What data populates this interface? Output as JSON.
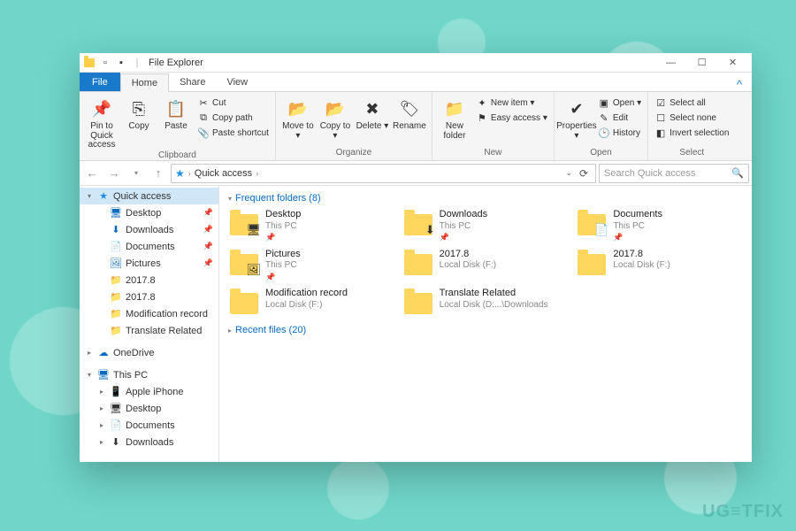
{
  "watermark": "UG≡TFIX",
  "title": "File Explorer",
  "win_buttons": {
    "min": "—",
    "max": "☐",
    "close": "✕"
  },
  "tabs": {
    "file": "File",
    "items": [
      "Home",
      "Share",
      "View"
    ],
    "active": 0,
    "help": "^"
  },
  "ribbon_groups": {
    "clipboard": {
      "label": "Clipboard",
      "pin": "Pin to Quick\naccess",
      "copy": "Copy",
      "paste": "Paste",
      "cut": "Cut",
      "copypath": "Copy path",
      "pasteshort": "Paste shortcut"
    },
    "organize": {
      "label": "Organize",
      "moveto": "Move\nto ▾",
      "copyto": "Copy\nto ▾",
      "delete": "Delete\n▾",
      "rename": "Rename"
    },
    "new": {
      "label": "New",
      "newfolder": "New\nfolder",
      "newitem": "New item ▾",
      "easyaccess": "Easy access ▾"
    },
    "open": {
      "label": "Open",
      "properties": "Properties\n▾",
      "open": "Open ▾",
      "edit": "Edit",
      "history": "History"
    },
    "select": {
      "label": "Select",
      "all": "Select all",
      "none": "Select none",
      "invert": "Invert selection"
    }
  },
  "nav": {
    "back": "←",
    "fwd": "→",
    "up": "↑"
  },
  "address": {
    "root": "Quick access",
    "refresh": "⟳"
  },
  "search": {
    "placeholder": "Search Quick access",
    "icon": "🔍"
  },
  "sidebar": {
    "quick": "Quick access",
    "quick_items": [
      {
        "name": "Desktop",
        "icon": "desktop"
      },
      {
        "name": "Downloads",
        "icon": "downloads"
      },
      {
        "name": "Documents",
        "icon": "documents"
      },
      {
        "name": "Pictures",
        "icon": "pictures"
      },
      {
        "name": "2017.8",
        "icon": "folder"
      },
      {
        "name": "2017.8",
        "icon": "folder"
      },
      {
        "name": "Modification record",
        "icon": "folder"
      },
      {
        "name": "Translate Related",
        "icon": "folder"
      }
    ],
    "onedrive": "OneDrive",
    "thispc": "This PC",
    "pc_items": [
      {
        "name": "Apple iPhone",
        "icon": "phone"
      },
      {
        "name": "Desktop",
        "icon": "desktop"
      },
      {
        "name": "Documents",
        "icon": "documents"
      },
      {
        "name": "Downloads",
        "icon": "downloads"
      }
    ]
  },
  "main": {
    "freq_label": "Frequent folders (8)",
    "freq": [
      {
        "name": "Desktop",
        "loc": "This PC",
        "pinned": true,
        "badge": "🖥"
      },
      {
        "name": "Downloads",
        "loc": "This PC",
        "pinned": true,
        "badge": "⬇"
      },
      {
        "name": "Documents",
        "loc": "This PC",
        "pinned": true,
        "badge": "📄"
      },
      {
        "name": "Pictures",
        "loc": "This PC",
        "pinned": true,
        "badge": "🖼"
      },
      {
        "name": "2017.8",
        "loc": "Local Disk (F:)",
        "pinned": false,
        "badge": ""
      },
      {
        "name": "2017.8",
        "loc": "Local Disk (F:)",
        "pinned": false,
        "badge": ""
      },
      {
        "name": "Modification record",
        "loc": "Local Disk (F:)",
        "pinned": false,
        "badge": ""
      },
      {
        "name": "Translate Related",
        "loc": "Local Disk (D:...\\Downloads",
        "pinned": false,
        "badge": ""
      }
    ],
    "recent_label": "Recent files (20)"
  }
}
